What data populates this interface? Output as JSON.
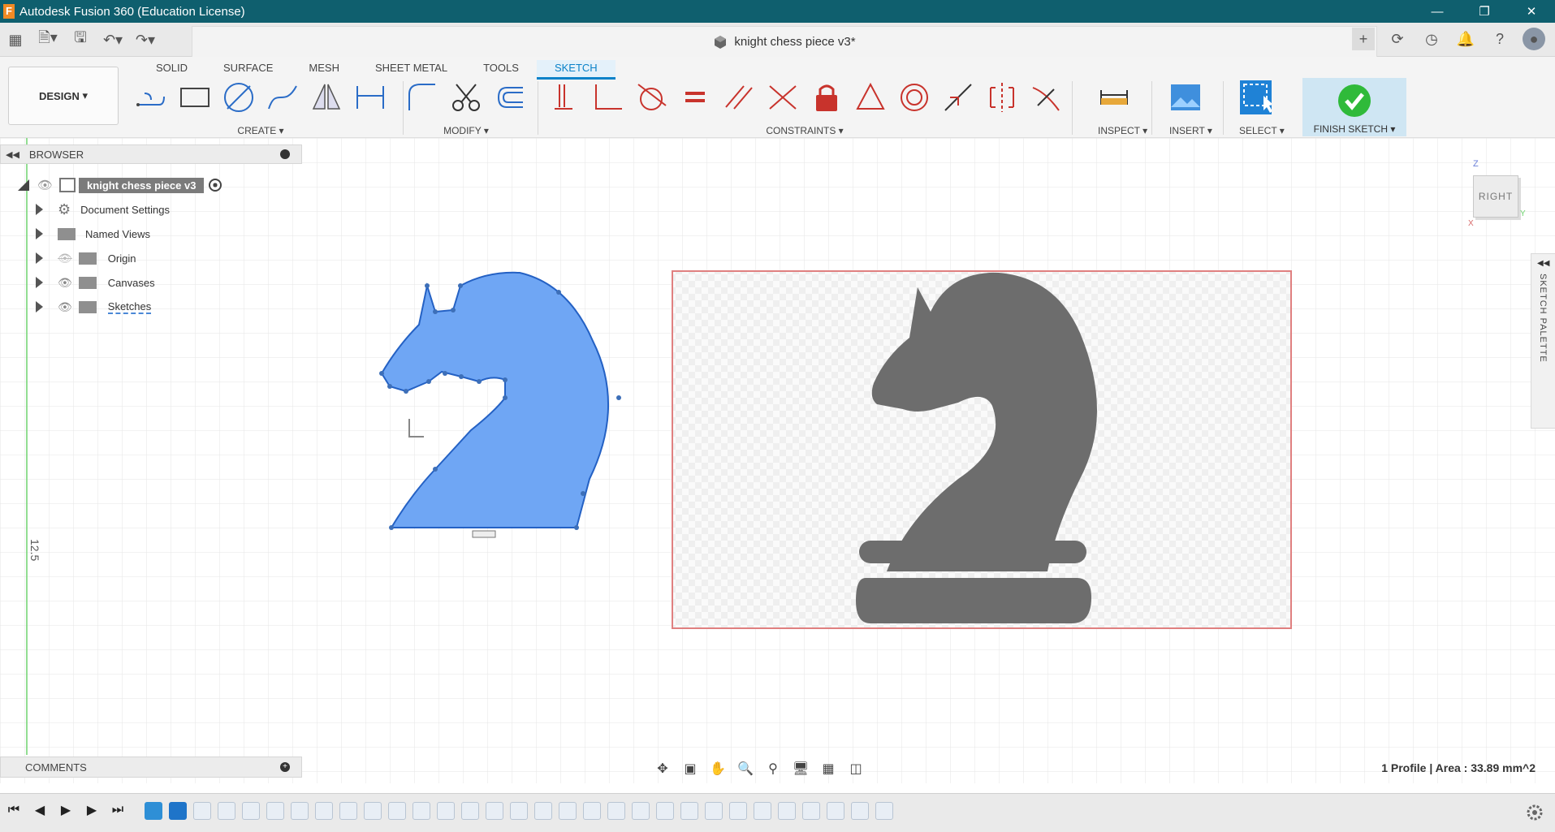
{
  "window": {
    "title": "Autodesk Fusion 360 (Education License)",
    "app_icon_letter": "F"
  },
  "document": {
    "tab_title": "knight chess piece v3*"
  },
  "toolbar": {
    "workspace": "DESIGN",
    "tabs": [
      "SOLID",
      "SURFACE",
      "MESH",
      "SHEET METAL",
      "TOOLS",
      "SKETCH"
    ],
    "active_tab": "SKETCH",
    "groups": {
      "create": "CREATE",
      "modify": "MODIFY",
      "constraints": "CONSTRAINTS",
      "inspect": "INSPECT",
      "insert": "INSERT",
      "select": "SELECT",
      "finish": "FINISH SKETCH"
    }
  },
  "browser": {
    "title": "BROWSER",
    "root": "knight chess piece v3",
    "items": [
      {
        "label": "Document Settings",
        "icon": "gear-icon"
      },
      {
        "label": "Named Views",
        "icon": "folder-icon"
      },
      {
        "label": "Origin",
        "icon": "folder-icon"
      },
      {
        "label": "Canvases",
        "icon": "folder-icon"
      },
      {
        "label": "Sketches",
        "icon": "folder-icon"
      }
    ]
  },
  "comments": {
    "title": "COMMENTS"
  },
  "canvas": {
    "ruler_label": "12.5",
    "viewcube_face": "RIGHT",
    "axis_z": "Z",
    "axis_y": "Y",
    "axis_x": "X"
  },
  "sketch_palette": {
    "label": "SKETCH PALETTE"
  },
  "status": {
    "profile_text": "1 Profile | Area : 33.89 mm^2"
  },
  "colors": {
    "title_bar": "#0f5f6e",
    "accent": "#0a82c9",
    "sketch_fill": "#6fa6f4",
    "sketch_stroke": "#2461c4",
    "canvas_image": "#6d6d6d",
    "canvas_border": "#e08080",
    "finish_green": "#2fba3a"
  }
}
